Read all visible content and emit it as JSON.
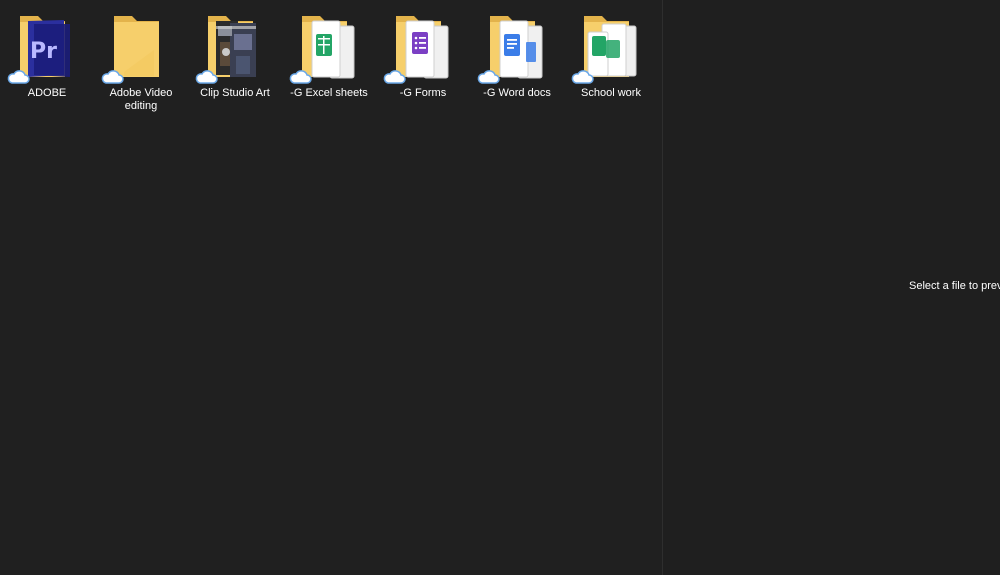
{
  "folders": [
    {
      "label": "ADOBE",
      "icon": "folder-premiere-pro-icon",
      "status_icon": "cloud-icon"
    },
    {
      "label": "Adobe Video editing",
      "icon": "folder-icon",
      "status_icon": "cloud-icon"
    },
    {
      "label": "Clip Studio Art",
      "icon": "folder-artwork-icon",
      "status_icon": "cloud-icon"
    },
    {
      "label": "-G Excel sheets",
      "icon": "folder-google-sheets-icon",
      "status_icon": "cloud-icon"
    },
    {
      "label": "-G Forms",
      "icon": "folder-google-forms-icon",
      "status_icon": "cloud-icon"
    },
    {
      "label": "-G Word docs",
      "icon": "folder-google-docs-icon",
      "status_icon": "cloud-icon"
    },
    {
      "label": "School work",
      "icon": "folder-documents-icon",
      "status_icon": "cloud-icon"
    }
  ],
  "preview": {
    "message": "Select a file to preview."
  },
  "colors": {
    "background": "#202020",
    "folder": "#f6cf6b",
    "folder_shadow": "#e3b34b",
    "cloud": "#6aa8e8"
  }
}
